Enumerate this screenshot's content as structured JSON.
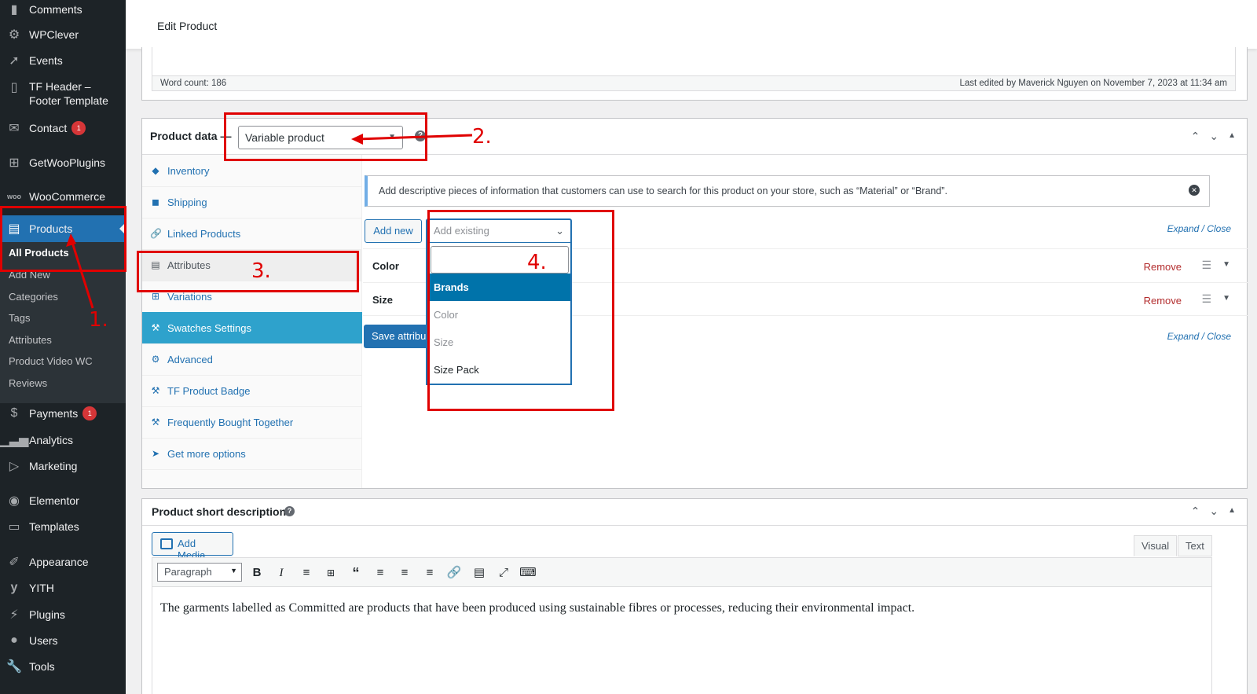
{
  "sidebar": {
    "items": [
      {
        "label": "Comments",
        "icon": "comment-icon"
      },
      {
        "label": "WPClever",
        "icon": "wpclever-icon"
      },
      {
        "label": "Events",
        "icon": "pin-icon"
      },
      {
        "label": "TF Header –",
        "label2": "Footer Template",
        "icon": "document-icon"
      },
      {
        "label": "Contact",
        "badge": "1",
        "icon": "envelope-icon"
      },
      {
        "label": "GetWooPlugins",
        "icon": "plus-icon"
      },
      {
        "label": "WooCommerce",
        "icon": "woo-icon"
      },
      {
        "label": "Products",
        "icon": "archive-icon"
      },
      {
        "label": "Payments",
        "badge": "1",
        "icon": "dollar-icon"
      },
      {
        "label": "Analytics",
        "icon": "bar-chart-icon"
      },
      {
        "label": "Marketing",
        "icon": "megaphone-icon"
      },
      {
        "label": "Elementor",
        "icon": "elementor-icon"
      },
      {
        "label": "Templates",
        "icon": "folder-icon"
      },
      {
        "label": "Appearance",
        "icon": "brush-icon"
      },
      {
        "label": "YITH",
        "icon": "yith-icon"
      },
      {
        "label": "Plugins",
        "icon": "plug-icon"
      },
      {
        "label": "Users",
        "icon": "user-icon"
      },
      {
        "label": "Tools",
        "icon": "wrench-icon"
      }
    ],
    "submenu": [
      "All Products",
      "Add New",
      "Categories",
      "Tags",
      "Attributes",
      "Product Video WC",
      "Reviews"
    ]
  },
  "header": {
    "title": "Edit Product"
  },
  "editor": {
    "word_count": "Word count: 186",
    "last_edited": "Last edited by Maverick Nguyen on November 7, 2023 at 11:34 am"
  },
  "product_data": {
    "title": "Product data —",
    "type_value": "Variable product",
    "tabs": [
      "Inventory",
      "Shipping",
      "Linked Products",
      "Attributes",
      "Variations",
      "Swatches Settings",
      "Advanced",
      "TF Product Badge",
      "Frequently Bought Together",
      "Get more options"
    ],
    "notice": "Add descriptive pieces of information that customers can use to search for this product on your store, such as “Material” or “Brand”.",
    "add_new": "Add new",
    "add_existing_placeholder": "Add existing",
    "dropdown_options": [
      "Brands",
      "Color",
      "Size",
      "Size Pack"
    ],
    "expand_close": "Expand / Close",
    "attributes": [
      {
        "name": "Color",
        "remove": "Remove"
      },
      {
        "name": "Size",
        "remove": "Remove"
      }
    ],
    "save_button": "Save attributes"
  },
  "short_description": {
    "title": "Product short description",
    "add_media": "Add Media",
    "tab_visual": "Visual",
    "tab_text": "Text",
    "format": "Paragraph",
    "content": "The garments labelled as Committed are products that have been produced using sustainable fibres or processes, reducing their environmental impact."
  },
  "annotations": [
    "1.",
    "2.",
    "3.",
    "4."
  ],
  "colors": {
    "sidebar_bg": "#1d2327",
    "accent": "#2271b1",
    "swatch_tab": "#2ea2cc",
    "annotation": "#e00000",
    "badge": "#d63638"
  }
}
